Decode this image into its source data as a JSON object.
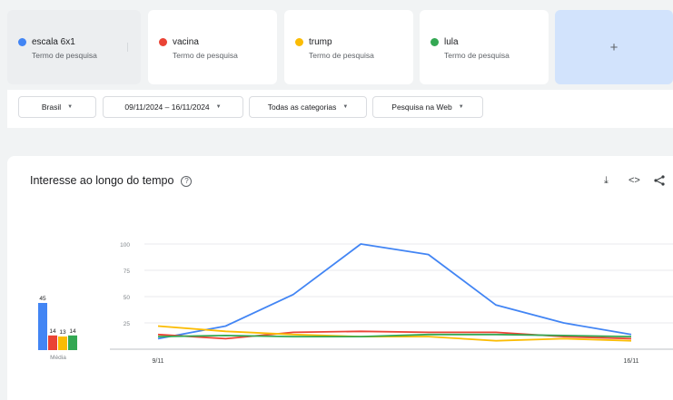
{
  "terms": [
    {
      "name": "escala 6x1",
      "subtitle": "Termo de pesquisa",
      "color": "#4285f4"
    },
    {
      "name": "vacina",
      "subtitle": "Termo de pesquisa",
      "color": "#ea4335"
    },
    {
      "name": "trump",
      "subtitle": "Termo de pesquisa",
      "color": "#fbbc04"
    },
    {
      "name": "lula",
      "subtitle": "Termo de pesquisa",
      "color": "#34a853"
    }
  ],
  "add_term_label": "+",
  "filters": {
    "region": "Brasil",
    "date_range": "09/11/2024 – 16/11/2024",
    "category": "Todas as categorias",
    "search_type": "Pesquisa na Web"
  },
  "panel": {
    "title": "Interesse ao longo do tempo",
    "help_icon": "question-circle-icon",
    "download_icon": "download-icon",
    "embed_icon": "code-icon",
    "share_icon": "share-icon"
  },
  "chart_data": {
    "type": "line",
    "ylim": [
      0,
      100
    ],
    "yticks": [
      "100",
      "75",
      "50",
      "25"
    ],
    "x_labels": [
      "9/11",
      "16/11"
    ],
    "series": [
      {
        "name": "escala 6x1",
        "color": "#4285f4",
        "values": [
          10,
          22,
          52,
          100,
          90,
          42,
          25,
          14
        ]
      },
      {
        "name": "vacina",
        "color": "#ea4335",
        "values": [
          14,
          10,
          16,
          17,
          16,
          16,
          12,
          10
        ]
      },
      {
        "name": "trump",
        "color": "#fbbc04",
        "values": [
          22,
          17,
          14,
          12,
          12,
          8,
          10,
          8
        ]
      },
      {
        "name": "lula",
        "color": "#34a853",
        "values": [
          12,
          13,
          12,
          12,
          14,
          14,
          13,
          12
        ]
      }
    ],
    "averages": {
      "label": "Média",
      "values": [
        45,
        14,
        13,
        14
      ]
    }
  }
}
